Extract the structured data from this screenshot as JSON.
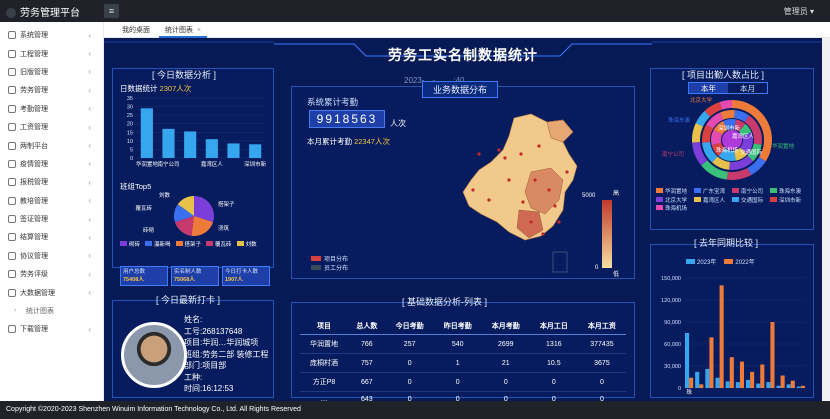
{
  "app": {
    "title": "劳务管理平台",
    "user": "管理员"
  },
  "sidebar": {
    "items": [
      {
        "label": "系统管理",
        "arrow": true
      },
      {
        "label": "工程管理",
        "arrow": true
      },
      {
        "label": "旧版管理",
        "arrow": true
      },
      {
        "label": "劳务管理",
        "arrow": true
      },
      {
        "label": "考勤管理",
        "arrow": true
      },
      {
        "label": "工资管理",
        "arrow": true
      },
      {
        "label": "两制平台",
        "arrow": true
      },
      {
        "label": "疫情管理",
        "arrow": true
      },
      {
        "label": "报税管理",
        "arrow": true
      },
      {
        "label": "教培管理",
        "arrow": true
      },
      {
        "label": "签证管理",
        "arrow": true
      },
      {
        "label": "结算管理",
        "arrow": true
      },
      {
        "label": "协议管理",
        "arrow": true
      },
      {
        "label": "劳务评级",
        "arrow": true
      },
      {
        "label": "大数据管理",
        "arrow": true
      },
      {
        "label": "统计图表",
        "arrow": false,
        "sub": true
      },
      {
        "label": "下载管理",
        "arrow": true
      }
    ]
  },
  "tabs": [
    {
      "label": "我的桌面"
    },
    {
      "label": "统计图表",
      "closable": "×"
    }
  ],
  "footer": "Copyright ©2020-2023 Shenzhen Winuim Information Technology Co., Ltd. All Rights Reserved",
  "dashboard": {
    "title": "劳务工实名制数据统计",
    "datetime": "2023-…-…  …:40",
    "daily": {
      "title": "今日数据分析",
      "stat_label": "日数据统计",
      "stat_value": "2307人次",
      "bar_chart": {
        "type": "bar",
        "categories": [
          "华润置地",
          "南宁公司",
          "",
          "嘉湾区人",
          "",
          "深圳市新"
        ],
        "values": [
          29,
          17,
          15.5,
          11,
          8.5,
          8
        ],
        "ylim": [
          0,
          35
        ],
        "yticks": [
          "0",
          "5",
          "10",
          "15",
          "20",
          "25",
          "30",
          "35"
        ],
        "color": "#36a7ef"
      },
      "top5_title": "班组Top5",
      "pie_chart": {
        "type": "pie",
        "slices": [
          {
            "name": "砌砖",
            "value": 30,
            "color": "#7b3ed9"
          },
          {
            "name": "混凝土",
            "value": 22,
            "color": "#ef7b3a"
          },
          {
            "name": "钢筋工",
            "value": 18,
            "color": "#c83a6e"
          },
          {
            "name": "瓦工",
            "value": 15,
            "color": "#3a6fef"
          },
          {
            "name": "刘数",
            "value": 15,
            "color": "#e7c14a"
          }
        ],
        "labels": [
          "刘数",
          "覆瓦砖",
          "砖砌",
          "搭架子",
          "浇筑"
        ],
        "legend": [
          {
            "name": "砌砖",
            "color": "#7b3ed9"
          },
          {
            "name": "瀑新喝",
            "color": "#3a6fef"
          },
          {
            "name": "搭架子",
            "color": "#ef7b3a"
          },
          {
            "name": "覆瓦砖",
            "color": "#c83a6e"
          },
          {
            "name": "刘数",
            "color": "#e7c14a"
          }
        ]
      },
      "stats": [
        {
          "label": "用户总数",
          "value": "75408人"
        },
        {
          "label": "实名制人数",
          "value": "75068人"
        },
        {
          "label": "今日打卡人数",
          "value": "1907人"
        }
      ]
    },
    "business": {
      "title": "业务数据分布",
      "total_label": "系统累计考勤",
      "total_value": "9918563",
      "total_unit": "人次",
      "month_label": "本月累计考勤",
      "month_value": "22347人次",
      "legend": [
        {
          "label": "项目分布",
          "color": "#d94040"
        },
        {
          "label": "员工分布",
          "color": "#3b4a5a"
        }
      ],
      "scale_max": "5000",
      "scale_min": "0",
      "scale_hi": "高",
      "scale_lo": "低"
    },
    "attendance": {
      "title": "项目出勤人数占比",
      "tabs": [
        "本年",
        "本月"
      ],
      "donut_labels": [
        "北京大学",
        "珠海东澳",
        "南宁公司",
        "华润置地",
        "深圳市新",
        "嘉湾区人",
        "珠海机场",
        "交通国际"
      ],
      "legend": [
        {
          "name": "华润置地",
          "color": "#ef7b3a"
        },
        {
          "name": "广东宝湾",
          "color": "#3a6fef"
        },
        {
          "name": "南宁公司",
          "color": "#c83a6e"
        },
        {
          "name": "珠海东澳",
          "color": "#3ac07b"
        },
        {
          "name": "北京大学",
          "color": "#7b3ed9"
        },
        {
          "name": "嘉湾区人",
          "color": "#e7c14a"
        },
        {
          "name": "交通国际",
          "color": "#36a7ef"
        },
        {
          "name": "深圳市新",
          "color": "#d94040"
        },
        {
          "name": "珠海机场",
          "color": "#e44ab0"
        }
      ]
    },
    "yoy": {
      "title": "去年同期比较",
      "chart": {
        "type": "bar",
        "series": [
          {
            "name": "2023年",
            "color": "#36a7ef",
            "values": [
              75000,
              22000,
              26000,
              14000,
              9000,
              8000,
              11000,
              6000,
              8000,
              3000,
              5000,
              2000
            ]
          },
          {
            "name": "2022年",
            "color": "#ef7b3a",
            "values": [
              14000,
              5000,
              69000,
              140000,
              42000,
              36000,
              22000,
              32000,
              90000,
              17000,
              10000,
              3000
            ]
          }
        ],
        "ylim": [
          0,
          150000
        ],
        "yticks": [
          "0",
          "30,000",
          "60,000",
          "90,000",
          "120,000",
          "150,000"
        ],
        "xlabel_first": "珠"
      }
    },
    "checkin": {
      "title": "今日最新打卡",
      "fields": [
        {
          "label": "姓名:",
          "value": ""
        },
        {
          "label": "工号:",
          "value": "268137648"
        },
        {
          "label": "项目:",
          "value": "华润…华润城项"
        },
        {
          "label": "班组:",
          "value": "劳务二部 装修工程"
        },
        {
          "label": "部门:",
          "value": "项目部"
        },
        {
          "label": "工种:",
          "value": ""
        },
        {
          "label": "时间:",
          "value": "16:12:53"
        }
      ]
    },
    "table": {
      "title": "基础数据分析-列表",
      "headers": [
        "项目",
        "总人数",
        "今日考勤",
        "昨日考勤",
        "本月考勤",
        "本月工日",
        "本月工资"
      ],
      "rows": [
        [
          "华润置地",
          "766",
          "257",
          "540",
          "2699",
          "1316",
          "377435"
        ],
        [
          "庞桐村酒",
          "757",
          "0",
          "1",
          "21",
          "10.5",
          "3675"
        ],
        [
          "方正P8",
          "667",
          "0",
          "0",
          "0",
          "0",
          "0"
        ],
        [
          "…",
          "643",
          "0",
          "0",
          "0",
          "0",
          "0"
        ]
      ]
    }
  }
}
